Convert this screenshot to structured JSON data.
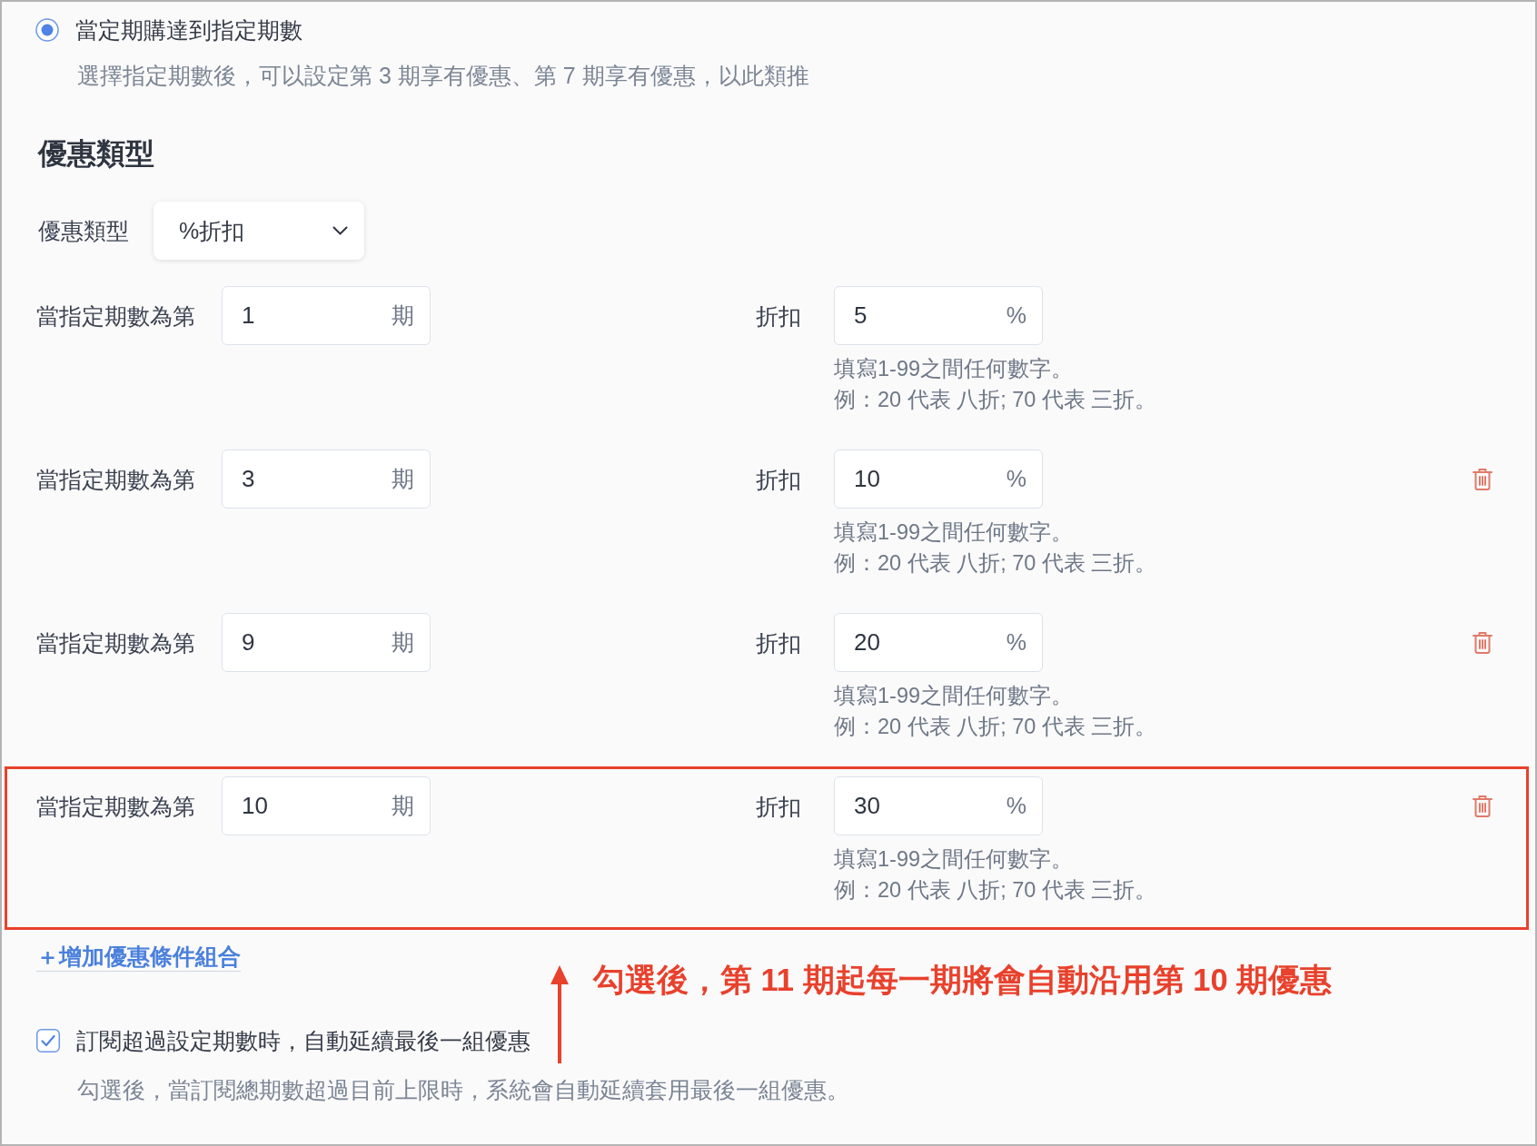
{
  "period_option": {
    "label": "當定期購達到指定期數",
    "selected": true,
    "description": "選擇指定期數後，可以設定第 3 期享有優惠、第 7 期享有優惠，以此類推"
  },
  "discount_type": {
    "title": "優惠類型",
    "field_label": "優惠類型",
    "value": "%折扣"
  },
  "rules": [
    {
      "period_label": "當指定期數為第",
      "period_value": "1",
      "period_unit": "期",
      "discount_label": "折扣",
      "discount_value": "5",
      "discount_unit": "%",
      "hints": [
        "填寫1-99之間任何數字。",
        "例：20 代表 八折; 70 代表 三折。"
      ],
      "deletable": false,
      "highlighted": false
    },
    {
      "period_label": "當指定期數為第",
      "period_value": "3",
      "period_unit": "期",
      "discount_label": "折扣",
      "discount_value": "10",
      "discount_unit": "%",
      "hints": [
        "填寫1-99之間任何數字。",
        "例：20 代表 八折; 70 代表 三折。"
      ],
      "deletable": true,
      "highlighted": false
    },
    {
      "period_label": "當指定期數為第",
      "period_value": "9",
      "period_unit": "期",
      "discount_label": "折扣",
      "discount_value": "20",
      "discount_unit": "%",
      "hints": [
        "填寫1-99之間任何數字。",
        "例：20 代表 八折; 70 代表 三折。"
      ],
      "deletable": true,
      "highlighted": false
    },
    {
      "period_label": "當指定期數為第",
      "period_value": "10",
      "period_unit": "期",
      "discount_label": "折扣",
      "discount_value": "30",
      "discount_unit": "%",
      "hints": [
        "填寫1-99之間任何數字。",
        "例：20 代表 八折; 70 代表 三折。"
      ],
      "deletable": true,
      "highlighted": true
    }
  ],
  "add_link": "＋增加優惠條件組合",
  "auto_extend": {
    "label": "訂閱超過設定期數時，自動延續最後一組優惠",
    "checked": true,
    "description": "勾選後，當訂閱總期數超過目前上限時，系統會自動延續套用最後一組優惠。"
  },
  "annotation": {
    "text": "勾選後，第 11 期起每一期將會自動沿用第 10 期優惠"
  }
}
